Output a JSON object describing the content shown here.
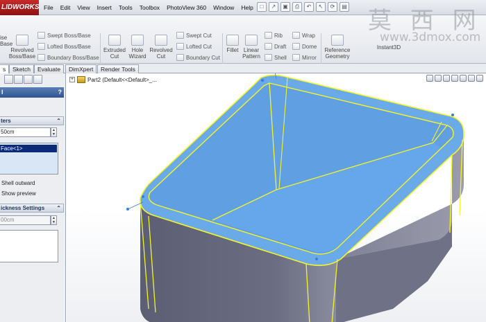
{
  "app": {
    "logo_text": "SOLIDWORKS",
    "logo_visible_text": "LIDWORKS",
    "accent_color": "#c62a2a"
  },
  "menu": {
    "items": [
      "File",
      "Edit",
      "View",
      "Insert",
      "Tools",
      "Toolbox",
      "PhotoView 360",
      "Window",
      "Help"
    ],
    "pin_glyph": "⊣"
  },
  "quick_access": {
    "icons": [
      "new-document-icon",
      "open-icon",
      "save-icon",
      "print-icon",
      "undo-icon",
      "select-icon",
      "rebuild-icon",
      "options-icon"
    ],
    "glyphs": [
      "□",
      "↗",
      "▣",
      "⎙",
      "↶",
      "↖",
      "⟳",
      "▤"
    ]
  },
  "watermark": {
    "chinese": "莫 西 网",
    "url": "www.3dmox.com"
  },
  "toolbar": {
    "left_partial_1": "ise",
    "left_partial_2": "Base",
    "revolved_boss": "Revolved\nBoss/Base",
    "swept_boss": "Swept Boss/Base",
    "lofted_boss": "Lofted Boss/Base",
    "boundary_boss": "Boundary Boss/Base",
    "extruded_cut": "Extruded\nCut",
    "hole_wizard": "Hole\nWizard",
    "revolved_cut": "Revolved\nCut",
    "swept_cut": "Swept Cut",
    "lofted_cut": "Lofted Cut",
    "boundary_cut": "Boundary Cut",
    "fillet": "Fillet",
    "linear_pattern": "Linear\nPattern",
    "rib": "Rib",
    "draft": "Draft",
    "shell": "Shell",
    "wrap": "Wrap",
    "dome": "Dome",
    "mirror": "Mirror",
    "reference_geometry": "Reference\nGeometry",
    "instant3d": "Instant3D"
  },
  "tabs": {
    "partial_first": "s",
    "items": [
      "Sketch",
      "Evaluate",
      "DimXpert",
      "Render Tools"
    ]
  },
  "property_manager": {
    "title_partial": "l",
    "help": "?",
    "parameters_header": "ters",
    "thickness_value": "50cm",
    "selected_face": "Face<1>",
    "shell_outward": "Shell outward",
    "show_preview": "Show preview",
    "multi_thickness_header": "ickness Settings",
    "multi_thickness_value": "00cm",
    "chevron": "⌃"
  },
  "graphics": {
    "tree_label": "Part2  (Default<<Default>_...",
    "tree_expand": "+",
    "model_face_color": "#6aaae8",
    "model_body_color": "#5a5c70",
    "edge_color": "#f5f52a"
  }
}
